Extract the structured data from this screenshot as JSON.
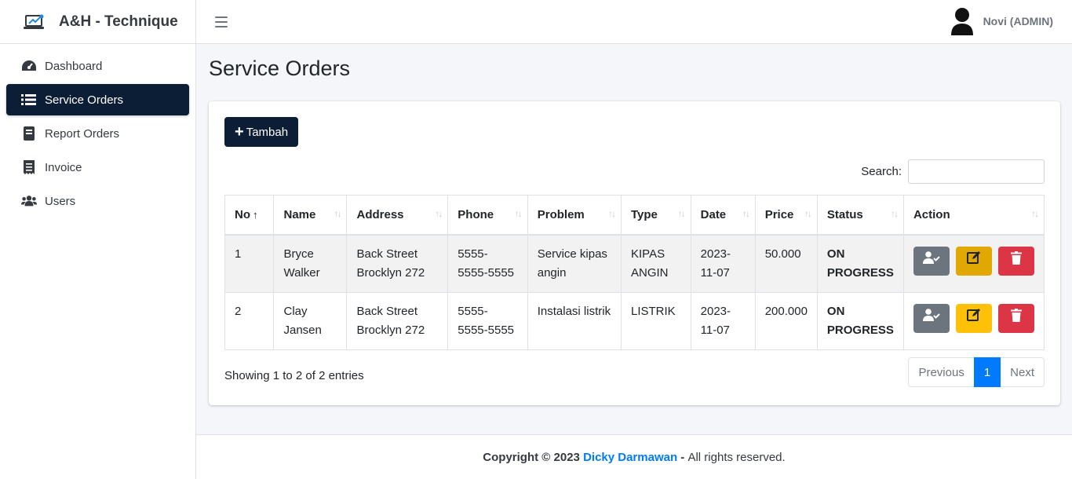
{
  "brand": {
    "name": "A&H - Technique"
  },
  "sidebar": {
    "items": [
      {
        "label": "Dashboard",
        "icon": "tachometer-icon",
        "active": false
      },
      {
        "label": "Service Orders",
        "icon": "list-icon",
        "active": true
      },
      {
        "label": "Report Orders",
        "icon": "book-icon",
        "active": false
      },
      {
        "label": "Invoice",
        "icon": "receipt-icon",
        "active": false
      },
      {
        "label": "Users",
        "icon": "users-icon",
        "active": false
      }
    ]
  },
  "header": {
    "user_name": "Novi (ADMIN)"
  },
  "page": {
    "title": "Service Orders"
  },
  "toolbar": {
    "add_label": "Tambah",
    "search_label": "Search:",
    "search_value": ""
  },
  "table": {
    "columns": [
      "No",
      "Name",
      "Address",
      "Phone",
      "Problem",
      "Type",
      "Date",
      "Price",
      "Status",
      "Action"
    ],
    "rows": [
      {
        "no": "1",
        "name": "Bryce Walker",
        "address": "Back Street Brocklyn 272",
        "phone": "5555-5555-5555",
        "problem": "Service kipas angin",
        "type": "KIPAS ANGIN",
        "date": "2023-11-07",
        "price": "50.000",
        "status": "ON PROGRESS"
      },
      {
        "no": "2",
        "name": "Clay Jansen",
        "address": "Back Street Brocklyn 272",
        "phone": "5555-5555-5555",
        "problem": "Instalasi listrik",
        "type": "LISTRIK",
        "date": "2023-11-07",
        "price": "200.000",
        "status": "ON PROGRESS"
      }
    ]
  },
  "pagination": {
    "info": "Showing 1 to 2 of 2 entries",
    "previous": "Previous",
    "current": "1",
    "next": "Next"
  },
  "footer": {
    "prefix": "Copyright © 2023",
    "author": "Dicky Darmawan",
    "dash": "-",
    "suffix": "All rights reserved."
  },
  "colors": {
    "primary_dark": "#0c1d36",
    "link": "#007bff",
    "grey_btn": "#6c757d",
    "warning_btn": "#ffc107",
    "danger_btn": "#dc3545"
  }
}
